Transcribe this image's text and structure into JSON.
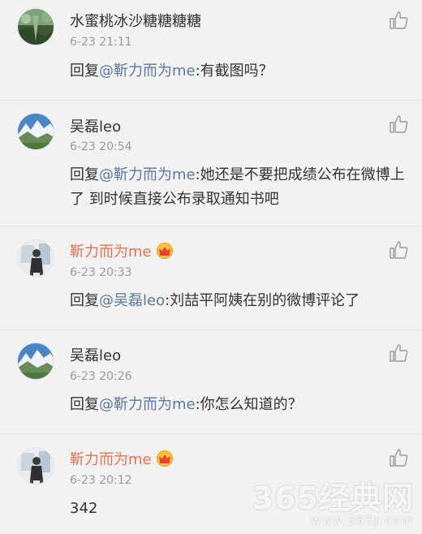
{
  "comments": [
    {
      "name": "水蜜桃冰沙糖糖糖糖",
      "time": "6-23 21:11",
      "reply_prefix": "回复",
      "mention": "@靳力而为me",
      "text": ":有截图吗？"
    },
    {
      "name": "吴磊leo",
      "time": "6-23 20:54",
      "reply_prefix": "回复",
      "mention": "@靳力而为me",
      "text": ":她还是不要把成绩公布在微博上了 到时候直接公布录取通知书吧"
    },
    {
      "name": "靳力而为me",
      "time": "6-23 20:33",
      "reply_prefix": "回复",
      "mention": "@吴磊leo",
      "text": ":刘喆平阿姨在别的微博评论了"
    },
    {
      "name": "吴磊leo",
      "time": "6-23 20:26",
      "reply_prefix": "回复",
      "mention": "@靳力而为me",
      "text": ":你怎么知道的？"
    },
    {
      "name": "靳力而为me",
      "time": "6-23 20:12",
      "text": "342"
    }
  ],
  "watermark": {
    "main": "365经典网",
    "sub": "www.365J.com"
  },
  "colors": {
    "background": "#f2f2f2",
    "mention": "#5b7a9f",
    "vip_name": "#eb7350",
    "time": "#9a9a9a"
  }
}
